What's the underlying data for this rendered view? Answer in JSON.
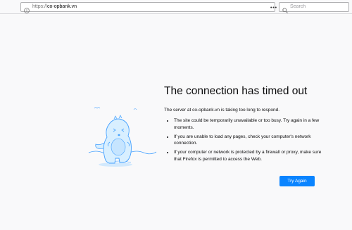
{
  "toolbar": {
    "url_scheme": "https://",
    "url_host": "co-opbank.vn",
    "search_placeholder": "Search"
  },
  "error": {
    "title": "The connection has timed out",
    "description": "The server at co-opbank.vn is taking too long to respond.",
    "bullets": [
      "The site could be temporarily unavailable or too busy. Try again in a few moments.",
      "If you are unable to load any pages, check your computer's network connection.",
      "If your computer or network is protected by a firewall or proxy, make sure that Firefox is permitted to access the Web."
    ],
    "try_again_label": "Try Again"
  },
  "colors": {
    "accent": "#0a84ff",
    "page_background": "#f9f9fa",
    "illustration_stroke": "#45a1ff",
    "illustration_fill": "#d8efff"
  },
  "icons": [
    "info-icon",
    "more-actions-icon",
    "pocket-icon",
    "bookmark-star-icon",
    "search-icon",
    "dinosaur-illustration"
  ]
}
